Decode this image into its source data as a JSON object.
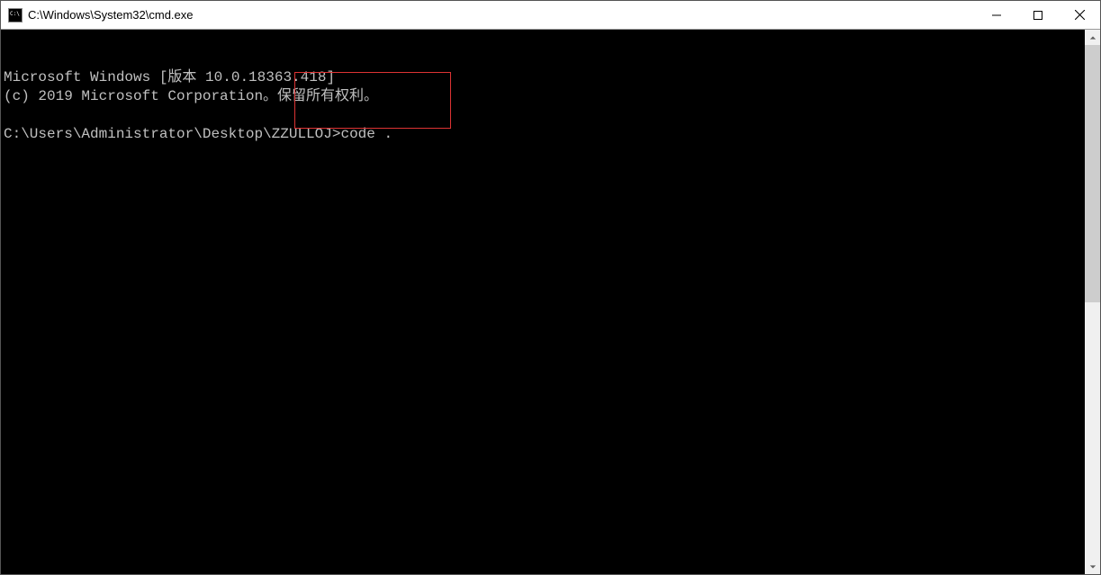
{
  "window": {
    "title": "C:\\Windows\\System32\\cmd.exe"
  },
  "terminal": {
    "line1": "Microsoft Windows [版本 10.0.18363.418]",
    "line2": "(c) 2019 Microsoft Corporation。保留所有权利。",
    "line3": "",
    "promptPath": "C:\\Users\\Administrator\\Desktop\\ZZULLOJ>",
    "command": "code ."
  },
  "icons": {
    "app": "cmd-icon",
    "minimize": "minimize-icon",
    "maximize": "maximize-icon",
    "close": "close-icon",
    "scrollUp": "scroll-up-icon",
    "scrollDown": "scroll-down-icon"
  }
}
